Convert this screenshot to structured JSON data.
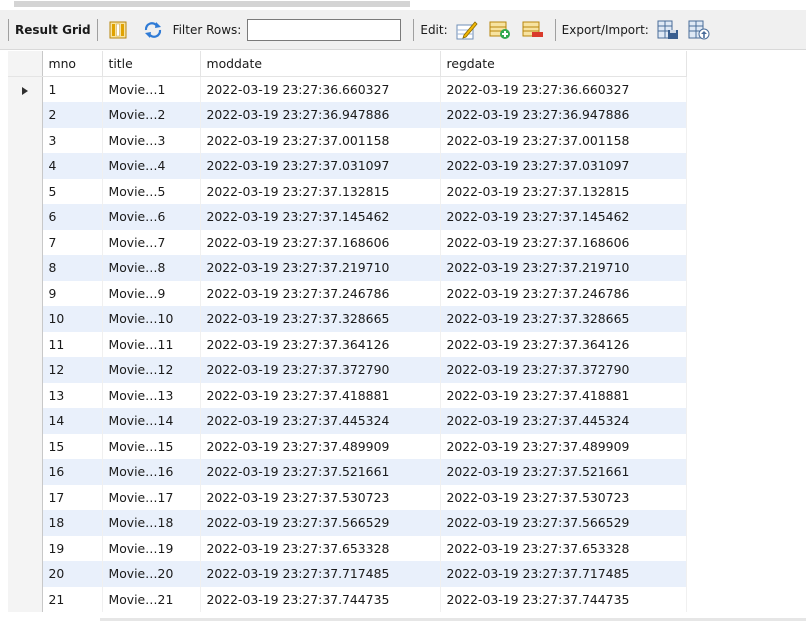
{
  "toolbar": {
    "result_grid_label": "Result Grid",
    "filter_rows_label": "Filter Rows:",
    "filter_value": "",
    "edit_label": "Edit:",
    "export_import_label": "Export/Import:"
  },
  "grid": {
    "columns": [
      "mno",
      "title",
      "moddate",
      "regdate"
    ],
    "selected_row": 0,
    "rows": [
      [
        "1",
        "Movie…1",
        "2022-03-19 23:27:36.660327",
        "2022-03-19 23:27:36.660327"
      ],
      [
        "2",
        "Movie…2",
        "2022-03-19 23:27:36.947886",
        "2022-03-19 23:27:36.947886"
      ],
      [
        "3",
        "Movie…3",
        "2022-03-19 23:27:37.001158",
        "2022-03-19 23:27:37.001158"
      ],
      [
        "4",
        "Movie…4",
        "2022-03-19 23:27:37.031097",
        "2022-03-19 23:27:37.031097"
      ],
      [
        "5",
        "Movie…5",
        "2022-03-19 23:27:37.132815",
        "2022-03-19 23:27:37.132815"
      ],
      [
        "6",
        "Movie…6",
        "2022-03-19 23:27:37.145462",
        "2022-03-19 23:27:37.145462"
      ],
      [
        "7",
        "Movie…7",
        "2022-03-19 23:27:37.168606",
        "2022-03-19 23:27:37.168606"
      ],
      [
        "8",
        "Movie…8",
        "2022-03-19 23:27:37.219710",
        "2022-03-19 23:27:37.219710"
      ],
      [
        "9",
        "Movie…9",
        "2022-03-19 23:27:37.246786",
        "2022-03-19 23:27:37.246786"
      ],
      [
        "10",
        "Movie…10",
        "2022-03-19 23:27:37.328665",
        "2022-03-19 23:27:37.328665"
      ],
      [
        "11",
        "Movie…11",
        "2022-03-19 23:27:37.364126",
        "2022-03-19 23:27:37.364126"
      ],
      [
        "12",
        "Movie…12",
        "2022-03-19 23:27:37.372790",
        "2022-03-19 23:27:37.372790"
      ],
      [
        "13",
        "Movie…13",
        "2022-03-19 23:27:37.418881",
        "2022-03-19 23:27:37.418881"
      ],
      [
        "14",
        "Movie…14",
        "2022-03-19 23:27:37.445324",
        "2022-03-19 23:27:37.445324"
      ],
      [
        "15",
        "Movie…15",
        "2022-03-19 23:27:37.489909",
        "2022-03-19 23:27:37.489909"
      ],
      [
        "16",
        "Movie…16",
        "2022-03-19 23:27:37.521661",
        "2022-03-19 23:27:37.521661"
      ],
      [
        "17",
        "Movie…17",
        "2022-03-19 23:27:37.530723",
        "2022-03-19 23:27:37.530723"
      ],
      [
        "18",
        "Movie…18",
        "2022-03-19 23:27:37.566529",
        "2022-03-19 23:27:37.566529"
      ],
      [
        "19",
        "Movie…19",
        "2022-03-19 23:27:37.653328",
        "2022-03-19 23:27:37.653328"
      ],
      [
        "20",
        "Movie…20",
        "2022-03-19 23:27:37.717485",
        "2022-03-19 23:27:37.717485"
      ],
      [
        "21",
        "Movie…21",
        "2022-03-19 23:27:37.744735",
        "2022-03-19 23:27:37.744735"
      ]
    ]
  }
}
